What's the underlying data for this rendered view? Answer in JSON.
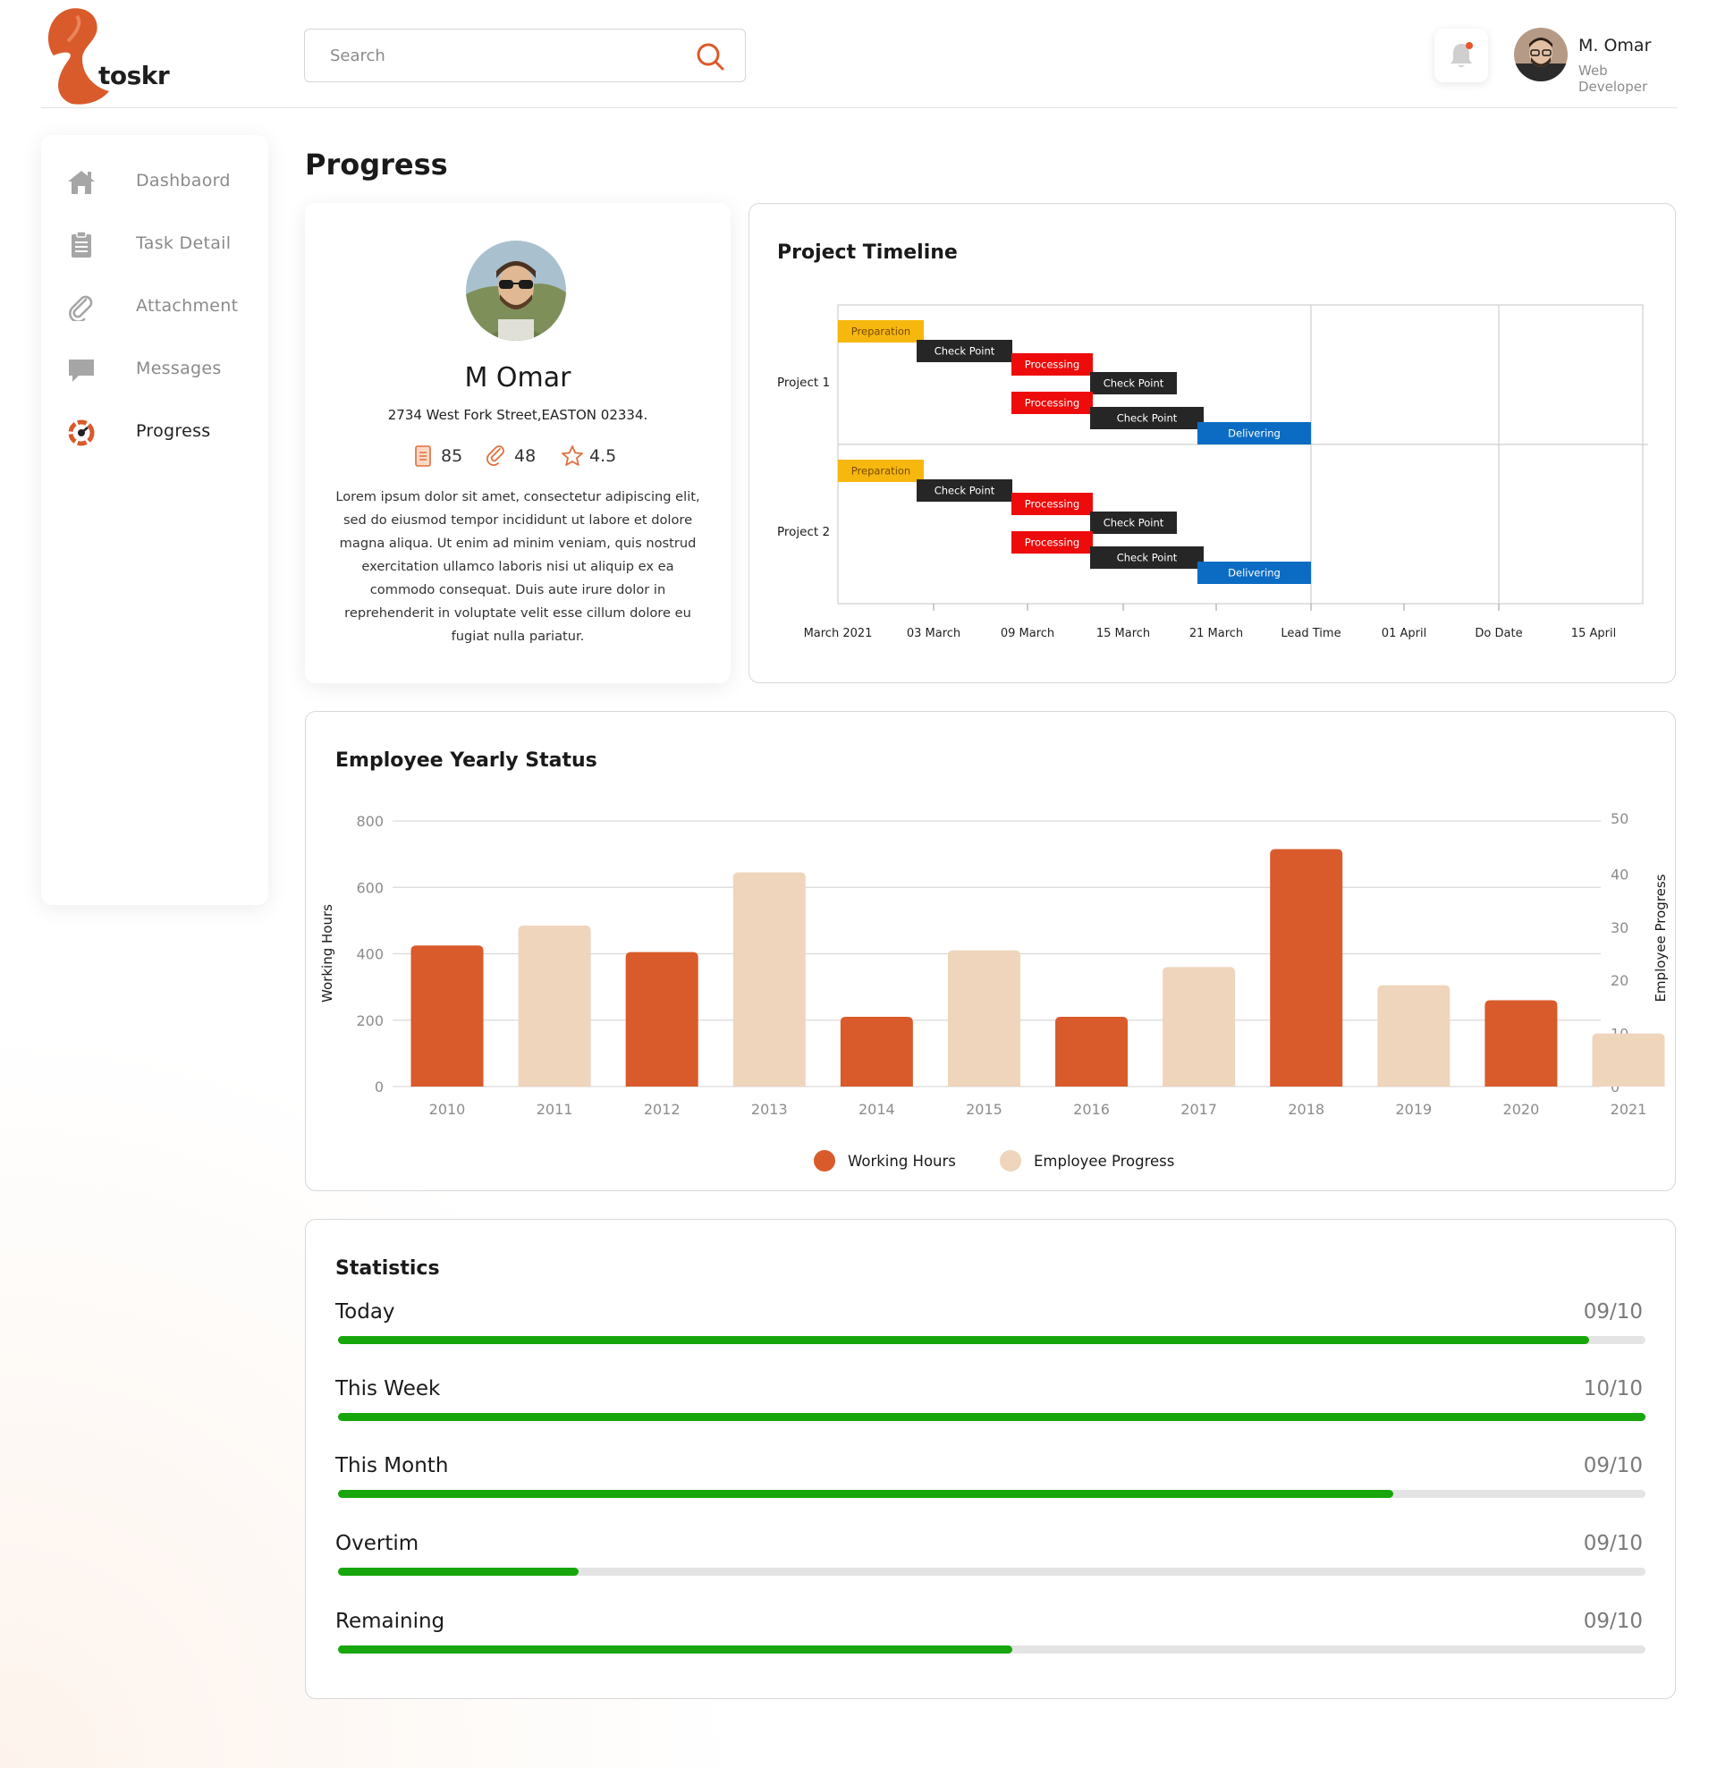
{
  "app": {
    "logo_text": "toskr"
  },
  "search": {
    "placeholder": "Search"
  },
  "user": {
    "name": "M. Omar",
    "role": "Web Developer"
  },
  "sidebar": {
    "items": [
      {
        "label": "Dashbaord",
        "icon": "home-icon",
        "active": false
      },
      {
        "label": "Task Detail",
        "icon": "clipboard-icon",
        "active": false
      },
      {
        "label": "Attachment",
        "icon": "paperclip-icon",
        "active": false
      },
      {
        "label": "Messages",
        "icon": "chat-icon",
        "active": false
      },
      {
        "label": "Progress",
        "icon": "progress-icon",
        "active": true
      }
    ]
  },
  "page": {
    "title": "Progress"
  },
  "profile": {
    "name": "M Omar",
    "address": "2734 West Fork Street,EASTON 02334.",
    "stats": [
      {
        "icon": "document-icon",
        "value": "85"
      },
      {
        "icon": "paperclip-icon",
        "value": "48"
      },
      {
        "icon": "star-icon",
        "value": "4.5"
      }
    ],
    "bio": "Lorem ipsum dolor sit amet, consectetur adipiscing elit, sed do eiusmod tempor incididunt ut labore et dolore magna aliqua. Ut enim ad minim veniam, quis nostrud exercitation ullamco laboris nisi ut aliquip ex ea commodo consequat. Duis aute irure dolor in reprehenderit in voluptate velit esse cillum dolore eu fugiat nulla pariatur."
  },
  "timeline": {
    "title": "Project Timeline",
    "x_labels": [
      "March 2021",
      "03 March",
      "09 March",
      "15 March",
      "21 March",
      "Lead Time",
      "01 April",
      "Do Date",
      "15 April"
    ],
    "projects": [
      {
        "name": "Project 1",
        "tasks": [
          {
            "label": "Preparation",
            "color": "#f6b80f",
            "text_color": "#7a4a00"
          },
          {
            "label": "Check Point",
            "color": "#262626",
            "text_color": "#ffffff"
          },
          {
            "label": "Processing",
            "color": "#ee0b0b",
            "text_color": "#ffffff"
          },
          {
            "label": "Check Point",
            "color": "#262626",
            "text_color": "#ffffff"
          },
          {
            "label": "Processing",
            "color": "#ee0b0b",
            "text_color": "#ffffff"
          },
          {
            "label": "Check Point",
            "color": "#262626",
            "text_color": "#ffffff"
          },
          {
            "label": "Delivering",
            "color": "#0c6cc4",
            "text_color": "#ffffff"
          }
        ]
      },
      {
        "name": "Project 2",
        "tasks": [
          {
            "label": "Preparation",
            "color": "#f6b80f",
            "text_color": "#7a4a00"
          },
          {
            "label": "Check Point",
            "color": "#262626",
            "text_color": "#ffffff"
          },
          {
            "label": "Processing",
            "color": "#ee0b0b",
            "text_color": "#ffffff"
          },
          {
            "label": "Check Point",
            "color": "#262626",
            "text_color": "#ffffff"
          },
          {
            "label": "Processing",
            "color": "#ee0b0b",
            "text_color": "#ffffff"
          },
          {
            "label": "Check Point",
            "color": "#262626",
            "text_color": "#ffffff"
          },
          {
            "label": "Delivering",
            "color": "#0c6cc4",
            "text_color": "#ffffff"
          }
        ]
      }
    ]
  },
  "chart_data": {
    "type": "bar",
    "title": "Employee Yearly Status",
    "categories": [
      "2010",
      "2011",
      "2012",
      "2013",
      "2014",
      "2015",
      "2016",
      "2017",
      "2018",
      "2019",
      "2020",
      "2021"
    ],
    "ylabel": "Working Hours",
    "y2label": "Employee Progress",
    "ylim": [
      0,
      800
    ],
    "y2lim": [
      0,
      50
    ],
    "yticks": [
      0,
      200,
      400,
      600,
      800
    ],
    "y2ticks": [
      0,
      10,
      20,
      30,
      40,
      50
    ],
    "grid": true,
    "legend_position": "bottom",
    "bar_values": [
      425,
      485,
      405,
      645,
      210,
      410,
      210,
      360,
      715,
      305,
      260,
      160
    ],
    "series": [
      {
        "name": "Working Hours",
        "color": "#d95a2b",
        "indices": [
          0,
          2,
          4,
          6,
          8,
          10
        ]
      },
      {
        "name": "Employee Progress",
        "color": "#eed5bb",
        "indices": [
          1,
          3,
          5,
          7,
          9,
          11
        ]
      }
    ]
  },
  "statistics": {
    "title": "Statistics",
    "rows": [
      {
        "label": "Today",
        "value": "09/10",
        "progress": 0.957
      },
      {
        "label": "This Week",
        "value": "10/10",
        "progress": 1.0
      },
      {
        "label": "This Month",
        "value": "09/10",
        "progress": 0.807
      },
      {
        "label": "Overtim",
        "value": "09/10",
        "progress": 0.184
      },
      {
        "label": "Remaining",
        "value": "09/10",
        "progress": 0.516
      }
    ]
  },
  "colors": {
    "accent": "#d95a2b",
    "progress_fill": "#17a60b",
    "progress_track": "#e4e4e4"
  }
}
